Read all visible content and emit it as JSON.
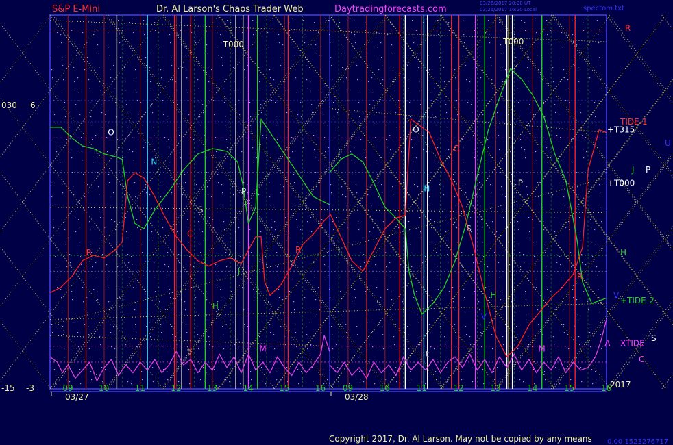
{
  "header": {
    "instrument": "S&P E-Mini",
    "site_title": "Dr. Al Larson's Chaos Trader Web",
    "site_url": "Daytradingforecasts.com",
    "timestamp_1": "03/26/2017 20:20 UT",
    "timestamp_2": "03/26/2017 16:20 Local",
    "spec_file": "spectom.txt"
  },
  "footer": {
    "copyright": "Copyright 2017, Dr. Al Larson. May not be copied by any means",
    "serial": "0.00 1523276717"
  },
  "colors": {
    "background": "#000046",
    "frame": "#3030c8",
    "price_line": "#ff2020",
    "flux_green": "#20d020",
    "tidal_magenta": "#e040e0",
    "fan_yellow": "#e8e020",
    "grid_red": "#a01818",
    "grid_green": "#0c5c0c",
    "title_red": "#ff3030",
    "title_yellow": "#f0f0a0",
    "title_magenta": "#ff40ff"
  },
  "chart_data": {
    "type": "line",
    "x_unit": "hour of session",
    "y_left_outer": {
      "top": "030",
      "bottom": "-15"
    },
    "y_left_inner": {
      "top": "6",
      "bottom": "-3"
    },
    "y_right_bottom": "2017",
    "days": [
      {
        "date": "03/27",
        "start": 8.5,
        "end": 16.25,
        "hour_ticks": [
          "09",
          "10",
          "11",
          "12",
          "13",
          "14",
          "15",
          "16"
        ],
        "marker_letters": [
          {
            "t": "O",
            "x": 10.1,
            "y": 6.3,
            "color": "#ffffff"
          },
          {
            "t": "C",
            "x": 12.3,
            "y": 2.5,
            "color": "#ff3030"
          },
          {
            "t": "N",
            "x": 11.3,
            "y": 5.2,
            "color": "#40e0ff"
          },
          {
            "t": "P",
            "x": 13.8,
            "y": 4.1,
            "color": "#ffffff"
          },
          {
            "t": "S",
            "x": 12.6,
            "y": 3.4,
            "color": "#c0c0c0"
          },
          {
            "t": "J",
            "x": 13.7,
            "y": 1.1,
            "color": "#20d020"
          },
          {
            "t": "H",
            "x": 13.0,
            "y": -0.2,
            "color": "#20d020"
          },
          {
            "t": "R",
            "x": 9.5,
            "y": 1.8,
            "color": "#ff3030"
          },
          {
            "t": "R",
            "x": 15.3,
            "y": 1.9,
            "color": "#ff3030"
          },
          {
            "t": "M",
            "x": 14.3,
            "y": -1.8,
            "color": "#ff40ff"
          },
          {
            "t": "T000",
            "x": 13.3,
            "y": 9.6,
            "color": "#f0f0a0"
          },
          {
            "t": "t",
            "x": 12.3,
            "y": -1.9,
            "color": "#c0c0c0"
          }
        ],
        "vlines": [
          {
            "x": 9.5,
            "c": "#b01818"
          },
          {
            "x": 10.35,
            "c": "#ffffff"
          },
          {
            "x": 11.2,
            "c": "#40e0ff"
          },
          {
            "x": 11.95,
            "c": "#ff2020"
          },
          {
            "x": 12.15,
            "c": "#ffffff"
          },
          {
            "x": 12.4,
            "c": "#ff2020"
          },
          {
            "x": 12.8,
            "c": "#20d020"
          },
          {
            "x": 13.65,
            "c": "#ffffff"
          },
          {
            "x": 13.85,
            "c": "#ffffff"
          },
          {
            "x": 14.0,
            "c": "#ff40ff"
          },
          {
            "x": 14.25,
            "c": "#20d020"
          },
          {
            "x": 15.1,
            "c": "#ff2020"
          }
        ],
        "price": [
          [
            8.5,
            0.4
          ],
          [
            8.8,
            0.6
          ],
          [
            9.1,
            1.0
          ],
          [
            9.4,
            1.6
          ],
          [
            9.7,
            1.8
          ],
          [
            10.0,
            1.7
          ],
          [
            10.3,
            2.0
          ],
          [
            10.5,
            2.3
          ],
          [
            10.65,
            4.6
          ],
          [
            10.85,
            4.9
          ],
          [
            11.1,
            4.7
          ],
          [
            11.4,
            4.0
          ],
          [
            11.7,
            3.2
          ],
          [
            12.0,
            2.5
          ],
          [
            12.3,
            2.0
          ],
          [
            12.6,
            1.6
          ],
          [
            12.9,
            1.4
          ],
          [
            13.2,
            1.6
          ],
          [
            13.5,
            1.7
          ],
          [
            13.8,
            1.5
          ],
          [
            14.0,
            2.0
          ],
          [
            14.2,
            2.5
          ],
          [
            14.35,
            2.5
          ],
          [
            14.45,
            0.8
          ],
          [
            14.6,
            0.3
          ],
          [
            14.9,
            0.7
          ],
          [
            15.2,
            1.4
          ],
          [
            15.5,
            2.2
          ],
          [
            15.8,
            2.6
          ],
          [
            16.1,
            3.1
          ],
          [
            16.25,
            3.3
          ]
        ],
        "flux": [
          [
            8.5,
            6.6
          ],
          [
            8.8,
            6.6
          ],
          [
            9.1,
            6.2
          ],
          [
            9.4,
            5.9
          ],
          [
            9.7,
            5.8
          ],
          [
            10.0,
            5.6
          ],
          [
            10.3,
            5.5
          ],
          [
            10.5,
            5.4
          ],
          [
            10.65,
            4.0
          ],
          [
            10.85,
            3.0
          ],
          [
            11.1,
            2.8
          ],
          [
            11.4,
            3.5
          ],
          [
            11.8,
            4.2
          ],
          [
            12.2,
            5.0
          ],
          [
            12.6,
            5.6
          ],
          [
            13.0,
            5.8
          ],
          [
            13.4,
            5.7
          ],
          [
            13.7,
            5.3
          ],
          [
            13.85,
            4.4
          ],
          [
            14.0,
            3.0
          ],
          [
            14.2,
            3.6
          ],
          [
            14.35,
            6.9
          ],
          [
            14.6,
            6.4
          ],
          [
            15.0,
            5.6
          ],
          [
            15.4,
            4.8
          ],
          [
            15.8,
            4.0
          ],
          [
            16.25,
            3.7
          ]
        ],
        "tidal": [
          [
            8.5,
            -2.0
          ],
          [
            8.7,
            -2.2
          ],
          [
            8.85,
            -2.6
          ],
          [
            9.0,
            -2.3
          ],
          [
            9.2,
            -2.8
          ],
          [
            9.4,
            -2.5
          ],
          [
            9.6,
            -2.2
          ],
          [
            9.8,
            -2.9
          ],
          [
            10.0,
            -2.4
          ],
          [
            10.2,
            -2.1
          ],
          [
            10.4,
            -2.7
          ],
          [
            10.6,
            -2.3
          ],
          [
            10.8,
            -2.6
          ],
          [
            11.0,
            -2.2
          ],
          [
            11.2,
            -2.5
          ],
          [
            11.4,
            -2.1
          ],
          [
            11.6,
            -2.6
          ],
          [
            11.8,
            -2.3
          ],
          [
            12.0,
            -1.8
          ],
          [
            12.2,
            -2.3
          ],
          [
            12.4,
            -2.1
          ],
          [
            12.6,
            -2.6
          ],
          [
            12.8,
            -2.2
          ],
          [
            13.0,
            -2.5
          ],
          [
            13.2,
            -1.9
          ],
          [
            13.4,
            -2.4
          ],
          [
            13.6,
            -2.0
          ],
          [
            13.8,
            -2.6
          ],
          [
            14.0,
            -1.9
          ],
          [
            14.2,
            -2.5
          ],
          [
            14.4,
            -2.2
          ],
          [
            14.6,
            -2.6
          ],
          [
            14.8,
            -2.0
          ],
          [
            15.0,
            -2.4
          ],
          [
            15.2,
            -2.7
          ],
          [
            15.4,
            -2.2
          ],
          [
            15.6,
            -2.6
          ],
          [
            15.8,
            -2.3
          ],
          [
            16.0,
            -1.9
          ],
          [
            16.1,
            -1.2
          ],
          [
            16.25,
            -1.8
          ]
        ]
      },
      {
        "date": "03/28",
        "start": 8.5,
        "end": 16.0,
        "hour_ticks": [
          "09",
          "10",
          "11",
          "12",
          "13",
          "14",
          "15",
          "16"
        ],
        "marker_letters": [
          {
            "t": "O",
            "x": 10.75,
            "y": 6.4,
            "color": "#ffffff"
          },
          {
            "t": "C",
            "x": 11.85,
            "y": 5.7,
            "color": "#ff3030"
          },
          {
            "t": "N",
            "x": 11.05,
            "y": 4.2,
            "color": "#40e0ff"
          },
          {
            "t": "P",
            "x": 13.6,
            "y": 4.4,
            "color": "#ffffff"
          },
          {
            "t": "S",
            "x": 12.2,
            "y": 2.7,
            "color": "#c0c0c0"
          },
          {
            "t": "H",
            "x": 12.85,
            "y": 0.2,
            "color": "#20d020"
          },
          {
            "t": "V",
            "x": 12.6,
            "y": -0.6,
            "color": "#3030ff"
          },
          {
            "t": "R",
            "x": 15.2,
            "y": 0.9,
            "color": "#ff3030"
          },
          {
            "t": "M",
            "x": 14.15,
            "y": -1.8,
            "color": "#ff40ff"
          },
          {
            "t": "T000",
            "x": 13.2,
            "y": 9.7,
            "color": "#f0f0a0"
          },
          {
            "t": "t",
            "x": 11.1,
            "y": -2.0,
            "color": "#c0c0c0"
          },
          {
            "t": "A",
            "x": 15.95,
            "y": -1.6,
            "color": "#ff40ff"
          }
        ],
        "vlines": [
          {
            "x": 9.5,
            "c": "#b01818"
          },
          {
            "x": 10.4,
            "c": "#ff2020"
          },
          {
            "x": 10.55,
            "c": "#ffffff"
          },
          {
            "x": 11.05,
            "c": "#40e0ff"
          },
          {
            "x": 11.15,
            "c": "#ffffff"
          },
          {
            "x": 11.8,
            "c": "#ff2020"
          },
          {
            "x": 12.0,
            "c": "#ff2020"
          },
          {
            "x": 12.45,
            "c": "#ff40ff"
          },
          {
            "x": 12.7,
            "c": "#20d020"
          },
          {
            "x": 13.3,
            "c": "#ffffff"
          },
          {
            "x": 13.35,
            "c": "#f0f060"
          },
          {
            "x": 13.45,
            "c": "#ffffff"
          },
          {
            "x": 14.25,
            "c": "#20d020"
          },
          {
            "x": 15.15,
            "c": "#ff2020"
          }
        ],
        "price": [
          [
            8.5,
            3.4
          ],
          [
            8.8,
            2.5
          ],
          [
            9.1,
            1.6
          ],
          [
            9.4,
            1.2
          ],
          [
            9.7,
            2.0
          ],
          [
            10.0,
            2.8
          ],
          [
            10.3,
            3.2
          ],
          [
            10.55,
            3.3
          ],
          [
            10.7,
            6.9
          ],
          [
            10.9,
            6.7
          ],
          [
            11.2,
            6.4
          ],
          [
            11.5,
            5.4
          ],
          [
            11.8,
            4.6
          ],
          [
            12.1,
            3.6
          ],
          [
            12.4,
            2.1
          ],
          [
            12.7,
            0.4
          ],
          [
            13.0,
            -1.2
          ],
          [
            13.3,
            -2.0
          ],
          [
            13.6,
            -1.6
          ],
          [
            13.9,
            -0.8
          ],
          [
            14.2,
            -0.3
          ],
          [
            14.5,
            0.2
          ],
          [
            14.8,
            0.6
          ],
          [
            15.1,
            1.1
          ],
          [
            15.35,
            2.1
          ],
          [
            15.5,
            5.0
          ],
          [
            15.8,
            6.5
          ],
          [
            16.0,
            6.4
          ]
        ],
        "flux": [
          [
            8.5,
            4.9
          ],
          [
            8.8,
            5.4
          ],
          [
            9.1,
            5.6
          ],
          [
            9.4,
            5.3
          ],
          [
            9.7,
            4.5
          ],
          [
            10.0,
            3.6
          ],
          [
            10.3,
            3.2
          ],
          [
            10.55,
            2.8
          ],
          [
            10.65,
            1.2
          ],
          [
            10.8,
            0.3
          ],
          [
            11.0,
            -0.4
          ],
          [
            11.3,
            0.0
          ],
          [
            11.6,
            0.6
          ],
          [
            11.9,
            1.6
          ],
          [
            12.2,
            3.0
          ],
          [
            12.5,
            4.8
          ],
          [
            12.8,
            6.5
          ],
          [
            13.1,
            7.7
          ],
          [
            13.4,
            8.8
          ],
          [
            13.7,
            8.4
          ],
          [
            14.0,
            7.8
          ],
          [
            14.3,
            7.0
          ],
          [
            14.6,
            5.6
          ],
          [
            14.9,
            4.6
          ],
          [
            15.2,
            2.4
          ],
          [
            15.35,
            0.8
          ],
          [
            15.6,
            0.0
          ],
          [
            15.8,
            0.1
          ],
          [
            16.0,
            0.2
          ]
        ],
        "tidal": [
          [
            8.5,
            -2.3
          ],
          [
            8.7,
            -2.6
          ],
          [
            8.9,
            -2.2
          ],
          [
            9.1,
            -2.7
          ],
          [
            9.3,
            -2.4
          ],
          [
            9.5,
            -2.8
          ],
          [
            9.7,
            -2.2
          ],
          [
            9.9,
            -2.6
          ],
          [
            10.1,
            -2.3
          ],
          [
            10.3,
            -2.7
          ],
          [
            10.5,
            -2.0
          ],
          [
            10.7,
            -2.5
          ],
          [
            10.9,
            -2.2
          ],
          [
            11.1,
            -2.5
          ],
          [
            11.3,
            -2.1
          ],
          [
            11.5,
            -2.6
          ],
          [
            11.7,
            -2.2
          ],
          [
            11.9,
            -2.0
          ],
          [
            12.1,
            -2.4
          ],
          [
            12.3,
            -1.9
          ],
          [
            12.5,
            -2.5
          ],
          [
            12.7,
            -2.1
          ],
          [
            12.9,
            -2.6
          ],
          [
            13.1,
            -2.0
          ],
          [
            13.3,
            -2.4
          ],
          [
            13.5,
            -1.9
          ],
          [
            13.7,
            -2.5
          ],
          [
            13.9,
            -2.1
          ],
          [
            14.1,
            -2.6
          ],
          [
            14.3,
            -2.2
          ],
          [
            14.5,
            -2.5
          ],
          [
            14.7,
            -2.0
          ],
          [
            14.9,
            -2.6
          ],
          [
            15.1,
            -2.2
          ],
          [
            15.3,
            -2.5
          ],
          [
            15.5,
            -2.4
          ],
          [
            15.7,
            -2.0
          ],
          [
            15.85,
            -1.4
          ],
          [
            16.0,
            -0.6
          ]
        ]
      }
    ],
    "right_labels": [
      {
        "t": "R",
        "y": 10.2,
        "color": "#ff3030"
      },
      {
        "t": "TIDE-1",
        "y": 6.7,
        "color": "#ff3030"
      },
      {
        "t": "+T315",
        "y": 6.4,
        "color": "#ffffff"
      },
      {
        "t": "U",
        "y": 5.9,
        "color": "#3030ff"
      },
      {
        "t": "J",
        "y": 4.9,
        "color": "#20d020"
      },
      {
        "t": "P",
        "y": 4.9,
        "color": "#ffffff"
      },
      {
        "t": "+T000",
        "y": 4.4,
        "color": "#ffffff"
      },
      {
        "t": "H",
        "y": 1.8,
        "color": "#20d020"
      },
      {
        "t": "V",
        "y": 0.2,
        "color": "#3030ff"
      },
      {
        "t": "+TIDE-2",
        "y": 0.0,
        "color": "#20d020"
      },
      {
        "t": "XTIDE",
        "y": -1.6,
        "color": "#ff40ff"
      },
      {
        "t": "S",
        "y": -1.4,
        "color": "#ffffff"
      },
      {
        "t": "C",
        "y": -2.2,
        "color": "#ff40ff"
      }
    ]
  }
}
